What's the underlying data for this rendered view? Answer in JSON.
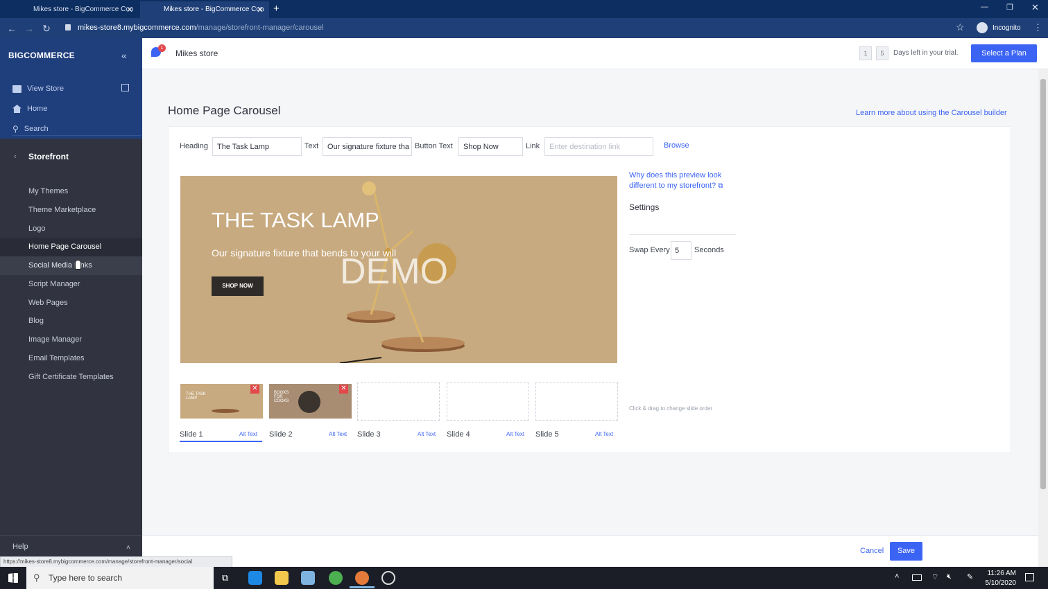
{
  "browser": {
    "tabs": [
      {
        "title": "Mikes store - BigCommerce Con",
        "active": false
      },
      {
        "title": "Mikes store - BigCommerce Con",
        "active": true
      }
    ],
    "url_host": "mikes-store8.mybigcommerce.com",
    "url_path": "/manage/storefront-manager/carousel",
    "profile": "Incognito",
    "status_url": "https://mikes-store8.mybigcommerce.com/manage/storefront-manager/social"
  },
  "sidebar": {
    "logo": "BIGCOMMERCE",
    "top_items": [
      {
        "label": "View Store",
        "icon": "store-icon"
      },
      {
        "label": "Home",
        "icon": "home-icon"
      },
      {
        "label": "Search",
        "icon": "search-icon"
      }
    ],
    "section": "Storefront",
    "items": [
      {
        "label": "My Themes"
      },
      {
        "label": "Theme Marketplace"
      },
      {
        "label": "Logo"
      },
      {
        "label": "Home Page Carousel",
        "selected": true
      },
      {
        "label": "Social Media Links",
        "hover": true
      },
      {
        "label": "Script Manager"
      },
      {
        "label": "Web Pages"
      },
      {
        "label": "Blog"
      },
      {
        "label": "Image Manager"
      },
      {
        "label": "Email Templates"
      },
      {
        "label": "Gift Certificate Templates"
      }
    ],
    "help": "Help"
  },
  "header": {
    "notification_count": "1",
    "store_name": "Mikes store",
    "trial_days": [
      "1",
      "5"
    ],
    "trial_text": "Days left in your trial.",
    "select_plan": "Select a Plan"
  },
  "page": {
    "title": "Home Page Carousel",
    "learn_link": "Learn more about using the Carousel builder",
    "form": {
      "heading_label": "Heading",
      "heading_value": "The Task Lamp",
      "text_label": "Text",
      "text_value": "Our signature fixture tha",
      "button_text_label": "Button Text",
      "button_text_value": "Shop Now",
      "link_label": "Link",
      "link_placeholder": "Enter destination link",
      "browse": "Browse"
    },
    "preview": {
      "heading": "THE TASK LAMP",
      "text": "Our signature fixture that bends to your will",
      "button": "SHOP NOW",
      "watermark": "DEMO"
    },
    "preview_help": "Why does this preview look different to my storefront?",
    "settings": {
      "title": "Settings",
      "swap_label": "Swap Every",
      "swap_value": "5",
      "swap_unit": "Seconds"
    },
    "slides": [
      {
        "label": "Slide 1",
        "alt": "Alt Text",
        "filled": true,
        "thumb_text": "THE TASK LAMP",
        "active": true
      },
      {
        "label": "Slide 2",
        "alt": "Alt Text",
        "filled": true,
        "thumb_text": "BOOKS FOR COOKS"
      },
      {
        "label": "Slide 3",
        "alt": "Alt Text",
        "filled": false
      },
      {
        "label": "Slide 4",
        "alt": "Alt Text",
        "filled": false
      },
      {
        "label": "Slide 5",
        "alt": "Alt Text",
        "filled": false
      }
    ],
    "drag_hint": "Click & drag to change slide order"
  },
  "footer": {
    "cancel": "Cancel",
    "save": "Save"
  },
  "taskbar": {
    "search_placeholder": "Type here to search",
    "time": "11:26 AM",
    "date": "5/10/2020"
  },
  "colors": {
    "accent": "#3c64f4",
    "sidebar": "#313440",
    "sidebar_top": "#1f3e7c",
    "chrome": "#0c2e61"
  }
}
